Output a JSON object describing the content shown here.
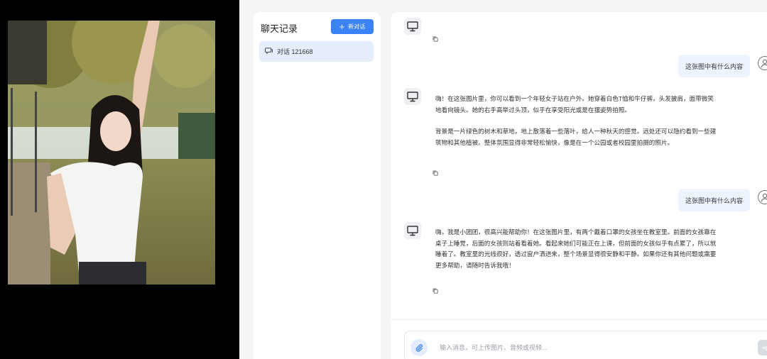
{
  "sidebar": {
    "title": "聊天记录",
    "new_button": "新对话",
    "conversations": [
      {
        "label": "对话 121668"
      }
    ]
  },
  "chat": {
    "messages": [
      {
        "role": "user",
        "text": "这张图中有什么内容"
      },
      {
        "role": "assistant",
        "paragraphs": [
          "嗨！在这张图片里，你可以看到一个年轻女子站在户外。她穿着白色T恤和牛仔裤，头发披肩，面带微笑地看向镜头。她的右手高举过头顶，似乎在享受阳光或是在摆姿势拍照。",
          "背景是一片绿色的树木和草地，地上散落着一些落叶，给人一种秋天的感觉。远处还可以隐约看到一些建筑物和其他植被。整体氛围显得非常轻松愉快，像是在一个公园或者校园里拍摄的照片。"
        ]
      },
      {
        "role": "user",
        "text": "这张图中有什么内容"
      },
      {
        "role": "assistant",
        "paragraphs": [
          "嗨，我是小团团，很高兴能帮助你！在这张图片里，有两个戴着口罩的女孩坐在教室里。前面的女孩靠在桌子上睡觉，后面的女孩则站着看着她。看起来她们可能正在上课，但前面的女孩似乎有点累了，所以就睡着了。教室里的光线很好，透过窗户洒进来，整个场景显得很安静和平静。如果你还有其他问题或需要更多帮助，请随时告诉我哦！"
        ]
      }
    ],
    "input_placeholder": "输入消息，可上传图片、音频或视频..."
  },
  "colors": {
    "accent": "#3b82f6",
    "selected_bg": "#e6eefc",
    "user_bubble": "#eef4fd"
  },
  "icons": {
    "new": "plus-icon",
    "conversation": "chat-icon",
    "bot": "monitor-icon",
    "user": "user-icon",
    "copy": "copy-icon",
    "attach": "paperclip-icon",
    "send": "send-icon"
  }
}
